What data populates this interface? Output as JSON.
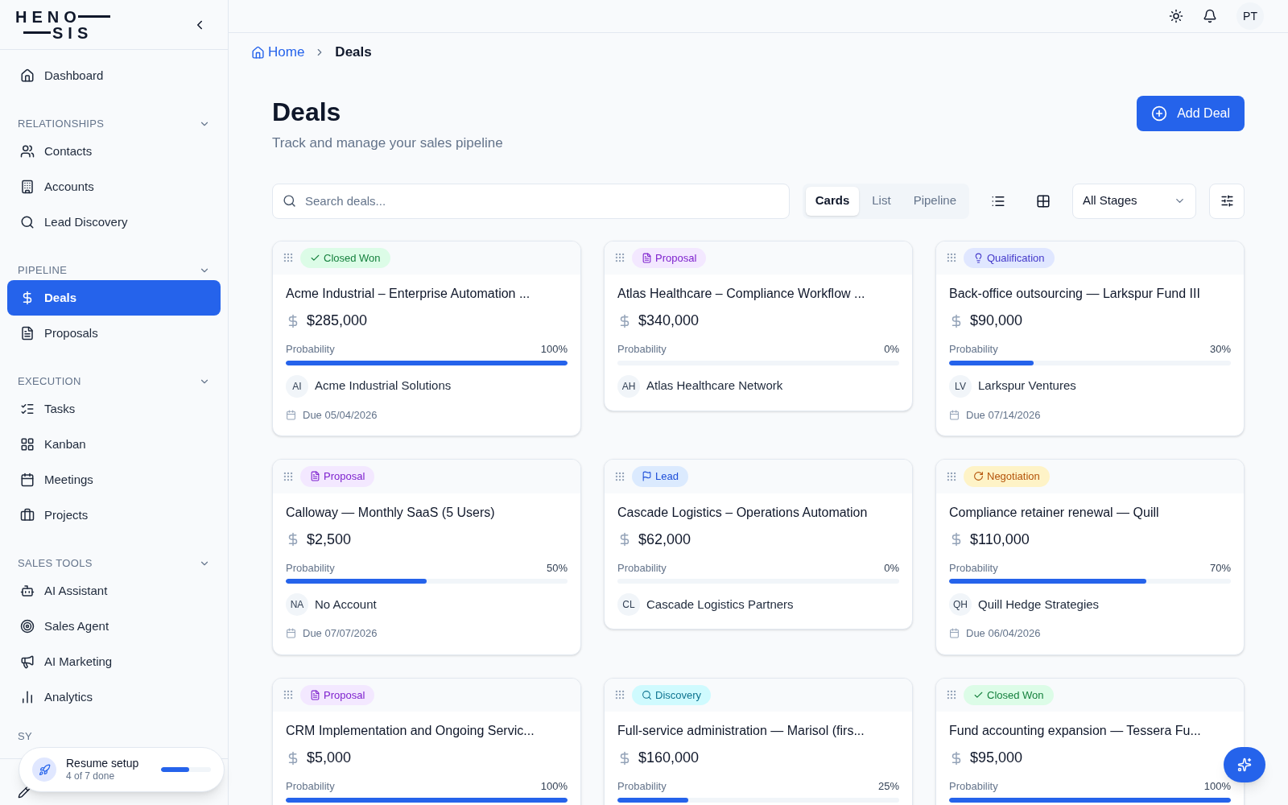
{
  "logo": {
    "lines": [
      "HENO",
      "SIS"
    ]
  },
  "sidebar": {
    "top_items": [
      {
        "label": "Dashboard",
        "selected": false
      }
    ],
    "sections": [
      {
        "title": "RELATIONSHIPS",
        "expanded": true,
        "items": [
          {
            "label": "Contacts",
            "selected": false
          },
          {
            "label": "Accounts",
            "selected": false
          },
          {
            "label": "Lead Discovery",
            "selected": false
          }
        ]
      },
      {
        "title": "PIPELINE",
        "expanded": true,
        "items": [
          {
            "label": "Deals",
            "selected": true
          },
          {
            "label": "Proposals",
            "selected": false
          }
        ]
      },
      {
        "title": "EXECUTION",
        "expanded": true,
        "items": [
          {
            "label": "Tasks",
            "selected": false
          },
          {
            "label": "Kanban",
            "selected": false
          },
          {
            "label": "Meetings",
            "selected": false
          },
          {
            "label": "Projects",
            "selected": false
          }
        ]
      },
      {
        "title": "SALES TOOLS",
        "expanded": true,
        "items": [
          {
            "label": "AI Assistant",
            "selected": false
          },
          {
            "label": "Sales Agent",
            "selected": false
          },
          {
            "label": "AI Marketing",
            "selected": false
          },
          {
            "label": "Analytics",
            "selected": false
          }
        ]
      }
    ],
    "cut_section_title": "SY"
  },
  "setup_popup": {
    "title": "Resume setup",
    "subtitle": "4 of 7 done",
    "level": 0.57
  },
  "header": {
    "avatar": "PT"
  },
  "breadcrumb": [
    {
      "label": "Home",
      "current": false
    },
    {
      "label": "Deals",
      "current": true
    }
  ],
  "page": {
    "title": "Deals",
    "subtitle": "Track and manage your sales pipeline",
    "add_button": "Add Deal"
  },
  "toolbar": {
    "search": {
      "placeholder": "Search deals..."
    },
    "view_tabs": [
      {
        "label": "Cards",
        "selected": true
      },
      {
        "label": "List",
        "selected": false
      },
      {
        "label": "Pipeline",
        "selected": false
      }
    ],
    "stage_filter": "All Stages"
  },
  "deals": [
    {
      "stage": {
        "kind": "closed_won",
        "label": "Closed Won"
      },
      "title": "Acme Industrial – Enterprise Automation ...",
      "amount": "$285,000",
      "probability_label": "Probability",
      "probability": "100%",
      "level": 1,
      "account_initials": "AI",
      "account": "Acme Industrial Solutions",
      "due": "Due 05/04/2026"
    },
    {
      "stage": {
        "kind": "proposal",
        "label": "Proposal"
      },
      "title": "Atlas Healthcare – Compliance Workflow ...",
      "amount": "$340,000",
      "probability_label": "Probability",
      "probability": "0%",
      "level": 0,
      "account_initials": "AH",
      "account": "Atlas Healthcare Network"
    },
    {
      "stage": {
        "kind": "qualification",
        "label": "Qualification"
      },
      "title": "Back-office outsourcing — Larkspur Fund III",
      "amount": "$90,000",
      "probability_label": "Probability",
      "probability": "30%",
      "level": 0.3,
      "account_initials": "LV",
      "account": "Larkspur Ventures",
      "due": "Due 07/14/2026"
    },
    {
      "stage": {
        "kind": "proposal",
        "label": "Proposal"
      },
      "title": "Calloway — Monthly SaaS (5 Users)",
      "amount": "$2,500",
      "probability_label": "Probability",
      "probability": "50%",
      "level": 0.5,
      "account_initials": "NA",
      "account": "No Account",
      "due": "Due 07/07/2026"
    },
    {
      "stage": {
        "kind": "lead",
        "label": "Lead"
      },
      "title": "Cascade Logistics – Operations Automation",
      "amount": "$62,000",
      "probability_label": "Probability",
      "probability": "0%",
      "level": 0,
      "account_initials": "CL",
      "account": "Cascade Logistics Partners"
    },
    {
      "stage": {
        "kind": "negotiation",
        "label": "Negotiation"
      },
      "title": "Compliance retainer renewal — Quill",
      "amount": "$110,000",
      "probability_label": "Probability",
      "probability": "70%",
      "level": 0.7,
      "account_initials": "QH",
      "account": "Quill Hedge Strategies",
      "due": "Due 06/04/2026"
    },
    {
      "stage": {
        "kind": "proposal",
        "label": "Proposal"
      },
      "title": "CRM Implementation and Ongoing Servic...",
      "amount": "$5,000",
      "probability_label": "Probability",
      "probability": "100%",
      "level": 1
    },
    {
      "stage": {
        "kind": "discovery",
        "label": "Discovery"
      },
      "title": "Full-service administration — Marisol (firs...",
      "amount": "$160,000",
      "probability_label": "Probability",
      "probability": "25%",
      "level": 0.25
    },
    {
      "stage": {
        "kind": "closed_won",
        "label": "Closed Won"
      },
      "title": "Fund accounting expansion — Tessera Fu...",
      "amount": "$95,000",
      "probability_label": "Probability",
      "probability": "100%",
      "level": 1
    }
  ]
}
